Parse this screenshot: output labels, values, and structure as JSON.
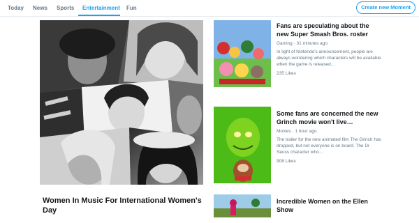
{
  "nav": {
    "tabs": [
      {
        "label": "Today"
      },
      {
        "label": "News"
      },
      {
        "label": "Sports"
      },
      {
        "label": "Entertainment",
        "active": true
      },
      {
        "label": "Fun"
      }
    ],
    "create_label": "Create new Moment"
  },
  "hero": {
    "title": "Women In Music For International Women's Day"
  },
  "cards": [
    {
      "title": "Fans are speculating about the new Super Smash Bros. roster",
      "category": "Gaming",
      "time": "31 minutes ago",
      "description": "In light of Nintendo's announcement, people are always wondering which characters will be available when the game is released…",
      "likes": "235 Likes"
    },
    {
      "title": "Some fans are concerned the new Grinch movie won't live…",
      "category": "Movies",
      "time": "1 hour ago",
      "description": "The trailer for the new animated film The Grinch has dropped, but not everyone is on board. The Dr Seuss character who…",
      "likes": "908 Likes"
    },
    {
      "title": "Incredible Women on the Ellen Show"
    }
  ],
  "colors": {
    "accent": "#1da1f2",
    "muted_text": "#657786",
    "grinch_bg": "#4cbb17"
  }
}
